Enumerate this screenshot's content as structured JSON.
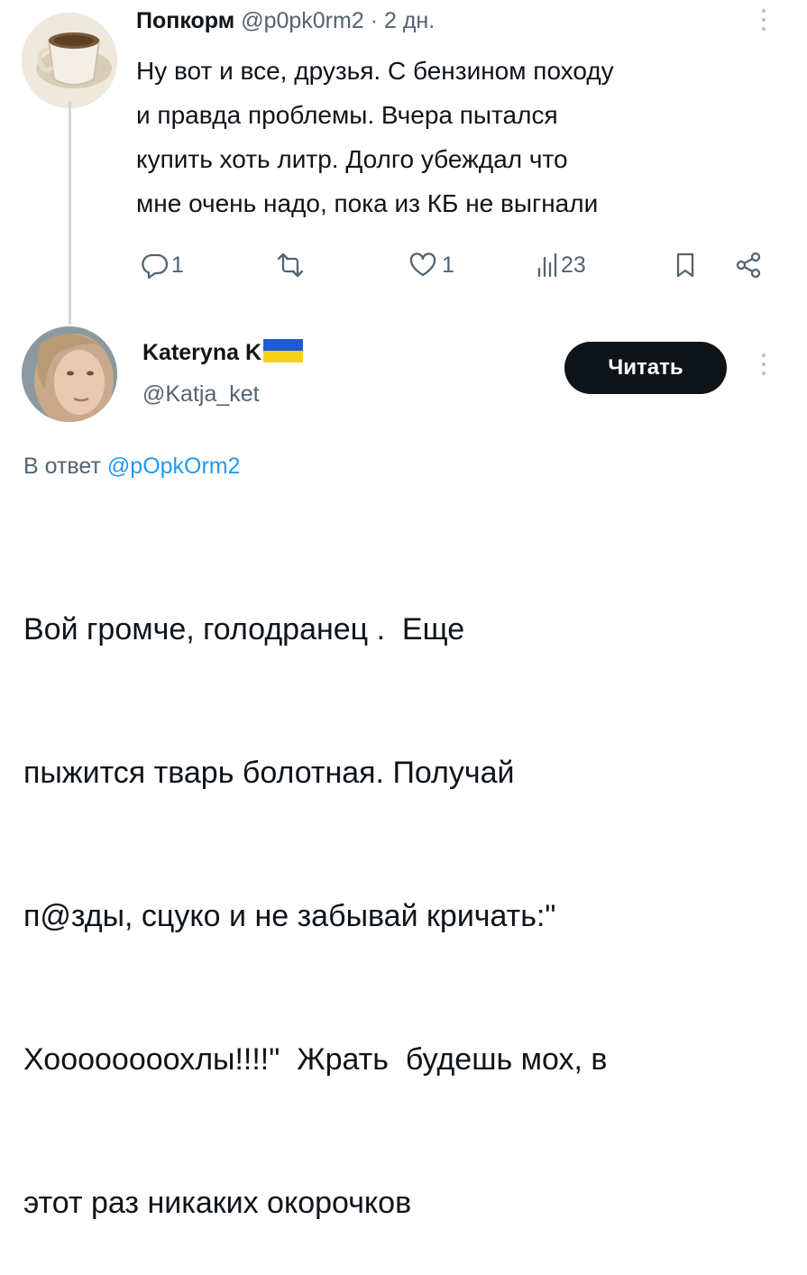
{
  "tweet1": {
    "author_name": "Попкорм",
    "author_handle": "@p0pk0rm2",
    "separator": "·",
    "time_ago": "2 дн.",
    "text_lines": [
      "Ну вот и все, друзья. С бензином походу",
      "и правда проблемы. Вчера пытался",
      "купить хоть литр. Долго убеждал что",
      "мне очень надо, пока из КБ не выгнали"
    ],
    "actions": {
      "reply_count": "1",
      "retweet_count": "",
      "like_count": "1",
      "views_count": "23"
    }
  },
  "tweet2": {
    "author_name": "Kateryna K",
    "author_handle": "@Katja_ket",
    "follow_label": "Читать",
    "reply_prefix": "В ответ",
    "reply_to_handle": "@pOpkOrm2",
    "text_lines": [
      "Вой громче, голодранец .  Еще",
      "пыжится тварь болотная. Получай",
      "п@зды, сцуко и не забывай кричать:\"",
      "Хоооооооохлы!!!!\"  Жрать  будешь мох, в",
      "этот раз никаких окорочков"
    ]
  },
  "colors": {
    "text": "#0f1419",
    "muted": "#536471",
    "link": "#1d9bf0",
    "button_bg": "#0f1419",
    "flag_blue": "#1c5bd6",
    "flag_yellow": "#f6d21a"
  },
  "icons": [
    "reply-icon",
    "retweet-icon",
    "like-icon",
    "views-icon",
    "bookmark-icon",
    "share-icon",
    "more-icon"
  ]
}
